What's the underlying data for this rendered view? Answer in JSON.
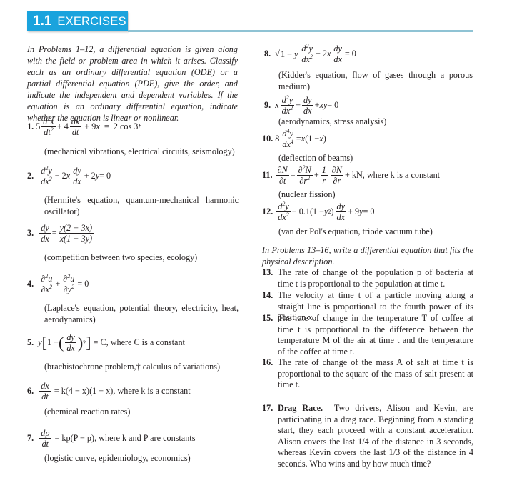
{
  "header": {
    "section_number": "1.1",
    "section_title": "EXERCISES",
    "accent_color": "#1aa3dd",
    "rule_color": "#8fc3d4"
  },
  "intro_1_12": "In Problems 1–12, a differential equation is given along with the field or problem area in which it arises. Classify each as an ordinary differential equation (ODE) or a partial differential equation (PDE), give the order, and indicate the independent and dependent variables. If the equation is an ordinary differential equation, indicate whether the equation is linear or nonlinear.",
  "problems": [
    {
      "number": "1.",
      "equation": "5 d²x/dt² + 4 dx/dt + 9x = 2 cos 3t",
      "description": "(mechanical vibrations, electrical circuits, seismology)"
    },
    {
      "number": "2.",
      "equation": "d²y/dx² − 2x dy/dx + 2y = 0",
      "description": "(Hermite's equation, quantum-mechanical harmonic oscillator)"
    },
    {
      "number": "3.",
      "equation": "dy/dx = y(2 − 3x) / x(1 − 3y)",
      "description": "(competition between two species, ecology)"
    },
    {
      "number": "4.",
      "equation": "∂²u/∂x² + ∂²u/∂y² = 0",
      "description": "(Laplace's equation, potential theory, electricity, heat, aerodynamics)"
    },
    {
      "number": "5.",
      "equation": "y[1 + (dy/dx)²] = C, where C is a constant",
      "equation_suffix": "= C, where C is a constant",
      "description": "(brachistochrone problem,† calculus of variations)"
    },
    {
      "number": "6.",
      "equation": "dx/dt = k(4 − x)(1 − x), where k is a constant",
      "equation_suffix": "= k(4 − x)(1 − x), where k is a constant",
      "description": "(chemical reaction rates)"
    },
    {
      "number": "7.",
      "equation": "dp/dt = kp(P − p), where k and P are constants",
      "equation_suffix": "= kp(P − p), where k and P are constants",
      "description": "(logistic curve, epidemiology, economics)"
    },
    {
      "number": "8.",
      "equation": "√(1 − y) d²y/dx² + 2x dy/dx = 0",
      "description": "(Kidder's equation, flow of gases through a porous medium)"
    },
    {
      "number": "9.",
      "equation": "x d²y/dx² + dy/dx + xy = 0",
      "description": "(aerodynamics, stress analysis)"
    },
    {
      "number": "10.",
      "equation": "8 d⁴y/dx⁴ = x(1 − x)",
      "description": "(deflection of beams)"
    },
    {
      "number": "11.",
      "equation": "∂N/∂t = ∂²N/∂r² + (1/r) ∂N/∂r + kN, where k is a constant",
      "equation_suffix": "+ kN, where k is a constant",
      "description": "(nuclear fission)"
    },
    {
      "number": "12.",
      "equation": "d²y/dx² − 0.1(1 − y²) dy/dx + 9y = 0",
      "description": "(van der Pol's equation, triode vacuum tube)"
    }
  ],
  "intro_13_16": "In Problems 13–16, write a differential equation that fits the physical description.",
  "word_problems": [
    {
      "number": "13.",
      "text": "The rate of change of the population p of bacteria at time t is proportional to the population at time t."
    },
    {
      "number": "14.",
      "text": "The velocity at time t of a particle moving along a straight line is proportional to the fourth power of its position x."
    },
    {
      "number": "15.",
      "text": "The rate of change in the temperature T of coffee at time t is proportional to the difference between the temperature M of the air at time t and the temperature of the coffee at time t."
    },
    {
      "number": "16.",
      "text": "The rate of change of the mass A of salt at time t is proportional to the square of the mass of salt present at time t."
    },
    {
      "number": "17.",
      "title": "Drag Race.",
      "text": "Two drivers, Alison and Kevin, are participating in a drag race. Beginning from a standing start, they each proceed with a constant acceleration. Alison covers the last 1/4 of the distance in 3 seconds, whereas Kevin covers the last 1/3 of the distance in 4 seconds. Who wins and by how much time?"
    }
  ]
}
